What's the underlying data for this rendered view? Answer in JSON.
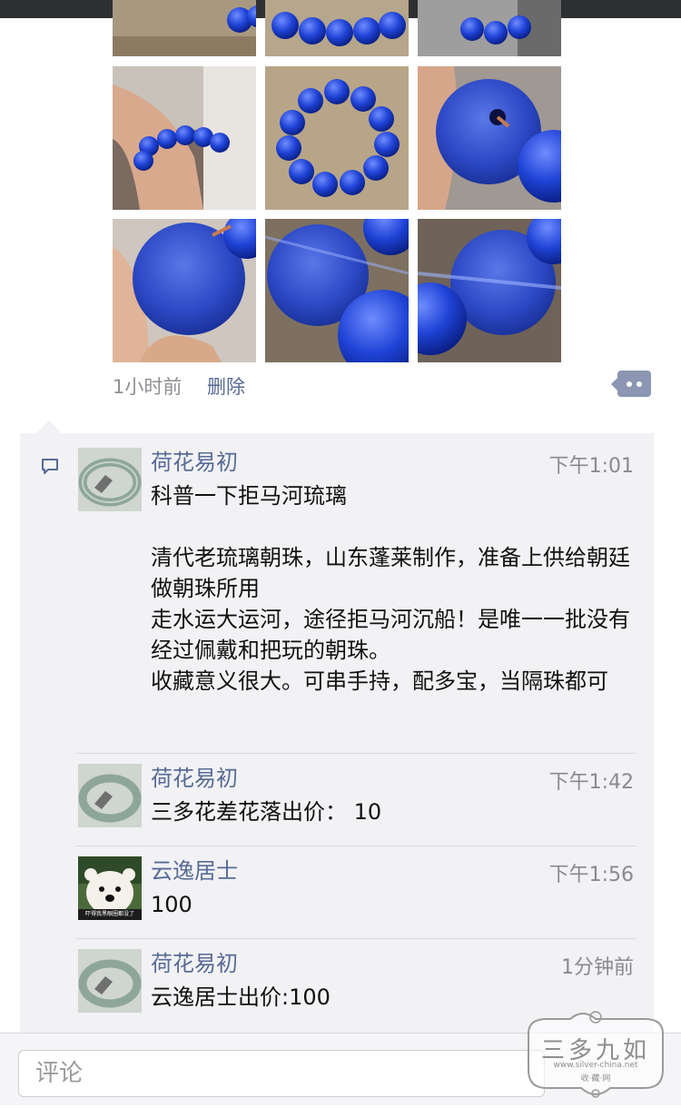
{
  "post": {
    "photos": [
      {
        "name": "bracelet-top-1",
        "style": "cut"
      },
      {
        "name": "bracelet-top-2",
        "style": "cut"
      },
      {
        "name": "bracelet-top-3",
        "style": "cut"
      },
      {
        "name": "bracelet-on-wrist",
        "style": "wrist"
      },
      {
        "name": "bracelet-on-cloth",
        "style": "ring"
      },
      {
        "name": "bead-closeup-hole",
        "style": "bead"
      },
      {
        "name": "bead-held-fingers",
        "style": "bead"
      },
      {
        "name": "beads-closeup-two",
        "style": "beads"
      },
      {
        "name": "beads-closeup-three",
        "style": "beads"
      }
    ],
    "time_ago": "1小时前",
    "delete_label": "删除"
  },
  "comments": [
    {
      "author": "荷花易初",
      "time": "下午1:01",
      "avatar": "jade-bangle",
      "lines": [
        "科普一下拒马河琉璃",
        "",
        "清代老琉璃朝珠，山东蓬莱制作，准备上供给朝廷做朝珠所用",
        "走水运大运河，途径拒马河沉船！是唯一一批没有经过佩戴和把玩的朝珠。",
        "收藏意义很大。可串手持，配多宝，当隔珠都可"
      ]
    },
    {
      "author": "荷花易初",
      "time": "下午1:42",
      "avatar": "jade-bangle",
      "text": "三多花差花落出价：  10"
    },
    {
      "author": "云逸居士",
      "time": "下午1:56",
      "avatar": "polar-bear",
      "avatar_caption": "吓得我黑眼圈都没了",
      "text": "100"
    },
    {
      "author": "荷花易初",
      "time": "1分钟前",
      "avatar": "jade-bangle",
      "text": "云逸居士出价:100"
    }
  ],
  "input": {
    "placeholder": "评论"
  },
  "watermark": {
    "title": "三多九如",
    "url": "www.silver-china.net",
    "sub": "收·藏·网"
  },
  "colors": {
    "link": "#576b95",
    "panel": "#f2f2f5",
    "bead_blue": "#1a3fd0"
  }
}
